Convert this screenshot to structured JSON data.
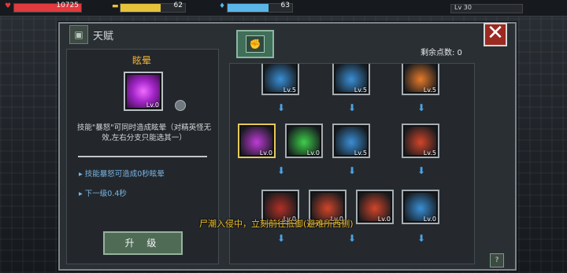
{
  "hud": {
    "health": {
      "value": "10725",
      "fill_percent": 100,
      "color": "#e0393e",
      "icon": "heart-icon"
    },
    "food": {
      "value": "62",
      "fill_percent": 62,
      "color": "#e6c23b",
      "icon": "food-icon"
    },
    "water": {
      "value": "63",
      "fill_percent": 63,
      "color": "#5ab6e8",
      "icon": "water-drop-icon"
    },
    "level": {
      "value": "Lv 30"
    }
  },
  "talent_panel": {
    "title": "天赋",
    "header_icon": "talent-book-icon",
    "tab_icon": "fist-tab-icon",
    "remaining_points_label": "剩余点数: 0",
    "close_icon": "close-icon"
  },
  "selected_skill": {
    "name": "眩晕",
    "level_label": "Lv.0",
    "description": "技能\"暴怒\"可同时造成眩晕（对精英怪无效,左右分支只能选其一）",
    "effect_current": "技能暴怒可造成0秒眩晕",
    "effect_next": "下一级0.4秒",
    "upgrade_button": "升 级"
  },
  "skill_tree": {
    "nodes": [
      {
        "name": "crosshair-skill",
        "level": "Lv.5",
        "color": "#3a8fd6"
      },
      {
        "name": "armor-skill",
        "level": "Lv.5",
        "color": "#3a8fd6"
      },
      {
        "name": "fire-burst-skill",
        "level": "Lv.5",
        "color": "#e87a2a"
      },
      {
        "name": "stun-skill",
        "level": "Lv.0",
        "color": "#c03ad8"
      },
      {
        "name": "green-rage-skill",
        "level": "Lv.0",
        "color": "#3ecf4a"
      },
      {
        "name": "hammer-skill",
        "level": "Lv.5",
        "color": "#3a8fd6"
      },
      {
        "name": "fury-skill",
        "level": "Lv.5",
        "color": "#d2452a"
      },
      {
        "name": "target-skill",
        "level": "Lv.0",
        "color": "#b23026"
      },
      {
        "name": "flame-body-skill",
        "level": "Lv.0",
        "color": "#d2452a"
      },
      {
        "name": "shield-skill",
        "level": "Lv.0",
        "color": "#d2452a"
      },
      {
        "name": "ammo-skill",
        "level": "Lv.0",
        "color": "#3a8fd6"
      }
    ]
  },
  "notice": "尸潮入侵中，立刻前往抵御(避难所西侧)",
  "corner_button": "?"
}
